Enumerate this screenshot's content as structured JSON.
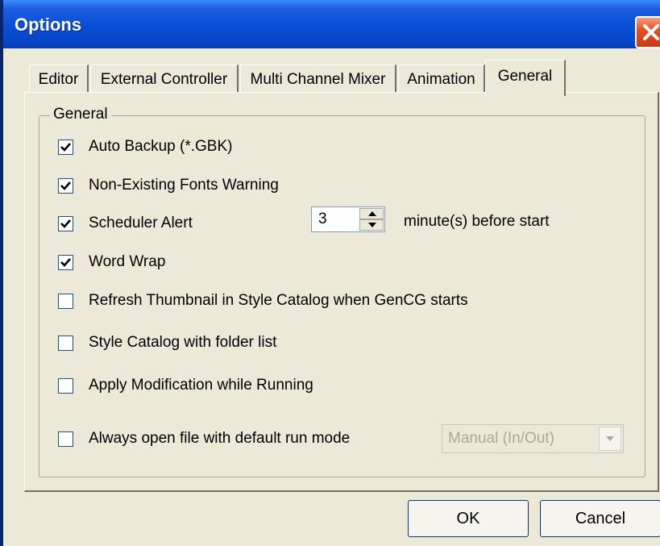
{
  "window": {
    "title": "Options"
  },
  "tabs": [
    {
      "label": "Editor",
      "active": false
    },
    {
      "label": "External Controller",
      "active": false
    },
    {
      "label": "Multi Channel Mixer",
      "active": false
    },
    {
      "label": "Animation",
      "active": false
    },
    {
      "label": "General",
      "active": true
    }
  ],
  "group": {
    "label": "General",
    "options": [
      {
        "label": "Auto Backup (*.GBK)",
        "checked": true
      },
      {
        "label": "Non-Existing Fonts Warning",
        "checked": true
      },
      {
        "label": "Scheduler Alert",
        "checked": true
      },
      {
        "label": "Word Wrap",
        "checked": true
      },
      {
        "label": "Refresh Thumbnail in Style Catalog when GenCG starts",
        "checked": false
      },
      {
        "label": "Style Catalog with folder list",
        "checked": false
      },
      {
        "label": "Apply Modification while Running",
        "checked": false
      },
      {
        "label": "Always open file with default run mode",
        "checked": false
      }
    ],
    "scheduler_minutes": "3",
    "scheduler_suffix": "minute(s) before start",
    "run_mode": {
      "selected": "Manual (In/Out)",
      "disabled": true
    }
  },
  "buttons": {
    "ok": "OK",
    "cancel": "Cancel"
  },
  "icons": {
    "close": "close-icon",
    "check": "check-icon",
    "spin_up": "arrow-up-icon",
    "spin_down": "arrow-down-icon",
    "dropdown": "chevron-down-icon"
  },
  "colors": {
    "titlebar": "#0a50d8",
    "face": "#ece9d8",
    "close": "#e2532a"
  }
}
